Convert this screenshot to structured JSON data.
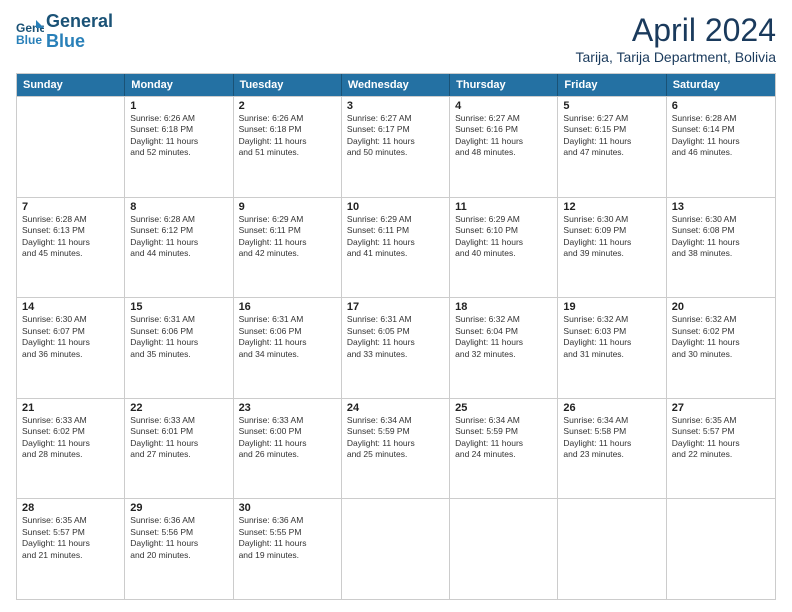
{
  "logo": {
    "line1": "General",
    "line2": "Blue"
  },
  "title": "April 2024",
  "subtitle": "Tarija, Tarija Department, Bolivia",
  "header_days": [
    "Sunday",
    "Monday",
    "Tuesday",
    "Wednesday",
    "Thursday",
    "Friday",
    "Saturday"
  ],
  "weeks": [
    [
      {
        "day": "",
        "info": ""
      },
      {
        "day": "1",
        "info": "Sunrise: 6:26 AM\nSunset: 6:18 PM\nDaylight: 11 hours\nand 52 minutes."
      },
      {
        "day": "2",
        "info": "Sunrise: 6:26 AM\nSunset: 6:18 PM\nDaylight: 11 hours\nand 51 minutes."
      },
      {
        "day": "3",
        "info": "Sunrise: 6:27 AM\nSunset: 6:17 PM\nDaylight: 11 hours\nand 50 minutes."
      },
      {
        "day": "4",
        "info": "Sunrise: 6:27 AM\nSunset: 6:16 PM\nDaylight: 11 hours\nand 48 minutes."
      },
      {
        "day": "5",
        "info": "Sunrise: 6:27 AM\nSunset: 6:15 PM\nDaylight: 11 hours\nand 47 minutes."
      },
      {
        "day": "6",
        "info": "Sunrise: 6:28 AM\nSunset: 6:14 PM\nDaylight: 11 hours\nand 46 minutes."
      }
    ],
    [
      {
        "day": "7",
        "info": "Sunrise: 6:28 AM\nSunset: 6:13 PM\nDaylight: 11 hours\nand 45 minutes."
      },
      {
        "day": "8",
        "info": "Sunrise: 6:28 AM\nSunset: 6:12 PM\nDaylight: 11 hours\nand 44 minutes."
      },
      {
        "day": "9",
        "info": "Sunrise: 6:29 AM\nSunset: 6:11 PM\nDaylight: 11 hours\nand 42 minutes."
      },
      {
        "day": "10",
        "info": "Sunrise: 6:29 AM\nSunset: 6:11 PM\nDaylight: 11 hours\nand 41 minutes."
      },
      {
        "day": "11",
        "info": "Sunrise: 6:29 AM\nSunset: 6:10 PM\nDaylight: 11 hours\nand 40 minutes."
      },
      {
        "day": "12",
        "info": "Sunrise: 6:30 AM\nSunset: 6:09 PM\nDaylight: 11 hours\nand 39 minutes."
      },
      {
        "day": "13",
        "info": "Sunrise: 6:30 AM\nSunset: 6:08 PM\nDaylight: 11 hours\nand 38 minutes."
      }
    ],
    [
      {
        "day": "14",
        "info": "Sunrise: 6:30 AM\nSunset: 6:07 PM\nDaylight: 11 hours\nand 36 minutes."
      },
      {
        "day": "15",
        "info": "Sunrise: 6:31 AM\nSunset: 6:06 PM\nDaylight: 11 hours\nand 35 minutes."
      },
      {
        "day": "16",
        "info": "Sunrise: 6:31 AM\nSunset: 6:06 PM\nDaylight: 11 hours\nand 34 minutes."
      },
      {
        "day": "17",
        "info": "Sunrise: 6:31 AM\nSunset: 6:05 PM\nDaylight: 11 hours\nand 33 minutes."
      },
      {
        "day": "18",
        "info": "Sunrise: 6:32 AM\nSunset: 6:04 PM\nDaylight: 11 hours\nand 32 minutes."
      },
      {
        "day": "19",
        "info": "Sunrise: 6:32 AM\nSunset: 6:03 PM\nDaylight: 11 hours\nand 31 minutes."
      },
      {
        "day": "20",
        "info": "Sunrise: 6:32 AM\nSunset: 6:02 PM\nDaylight: 11 hours\nand 30 minutes."
      }
    ],
    [
      {
        "day": "21",
        "info": "Sunrise: 6:33 AM\nSunset: 6:02 PM\nDaylight: 11 hours\nand 28 minutes."
      },
      {
        "day": "22",
        "info": "Sunrise: 6:33 AM\nSunset: 6:01 PM\nDaylight: 11 hours\nand 27 minutes."
      },
      {
        "day": "23",
        "info": "Sunrise: 6:33 AM\nSunset: 6:00 PM\nDaylight: 11 hours\nand 26 minutes."
      },
      {
        "day": "24",
        "info": "Sunrise: 6:34 AM\nSunset: 5:59 PM\nDaylight: 11 hours\nand 25 minutes."
      },
      {
        "day": "25",
        "info": "Sunrise: 6:34 AM\nSunset: 5:59 PM\nDaylight: 11 hours\nand 24 minutes."
      },
      {
        "day": "26",
        "info": "Sunrise: 6:34 AM\nSunset: 5:58 PM\nDaylight: 11 hours\nand 23 minutes."
      },
      {
        "day": "27",
        "info": "Sunrise: 6:35 AM\nSunset: 5:57 PM\nDaylight: 11 hours\nand 22 minutes."
      }
    ],
    [
      {
        "day": "28",
        "info": "Sunrise: 6:35 AM\nSunset: 5:57 PM\nDaylight: 11 hours\nand 21 minutes."
      },
      {
        "day": "29",
        "info": "Sunrise: 6:36 AM\nSunset: 5:56 PM\nDaylight: 11 hours\nand 20 minutes."
      },
      {
        "day": "30",
        "info": "Sunrise: 6:36 AM\nSunset: 5:55 PM\nDaylight: 11 hours\nand 19 minutes."
      },
      {
        "day": "",
        "info": ""
      },
      {
        "day": "",
        "info": ""
      },
      {
        "day": "",
        "info": ""
      },
      {
        "day": "",
        "info": ""
      }
    ]
  ]
}
